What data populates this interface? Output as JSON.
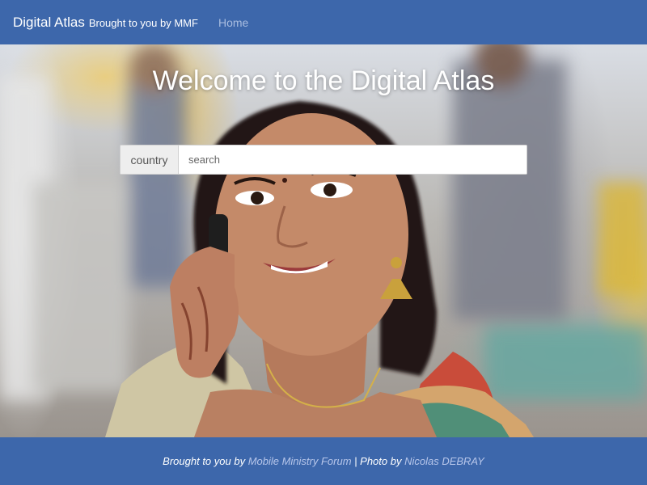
{
  "navbar": {
    "brand_title": "Digital Atlas",
    "brand_subtitle": "Brought to you by MMF",
    "home_link": "Home"
  },
  "hero": {
    "title": "Welcome to the Digital Atlas",
    "search": {
      "addon_label": "country",
      "placeholder": "search",
      "value": ""
    }
  },
  "footer": {
    "prefix": "Brought to you by ",
    "org_link": "Mobile Ministry Forum",
    "separator": " | Photo by ",
    "photographer_link": "Nicolas DEBRAY"
  },
  "colors": {
    "nav_background": "#3d67ab",
    "footer_link": "#b7c6ea",
    "home_link": "#a9bde0"
  }
}
